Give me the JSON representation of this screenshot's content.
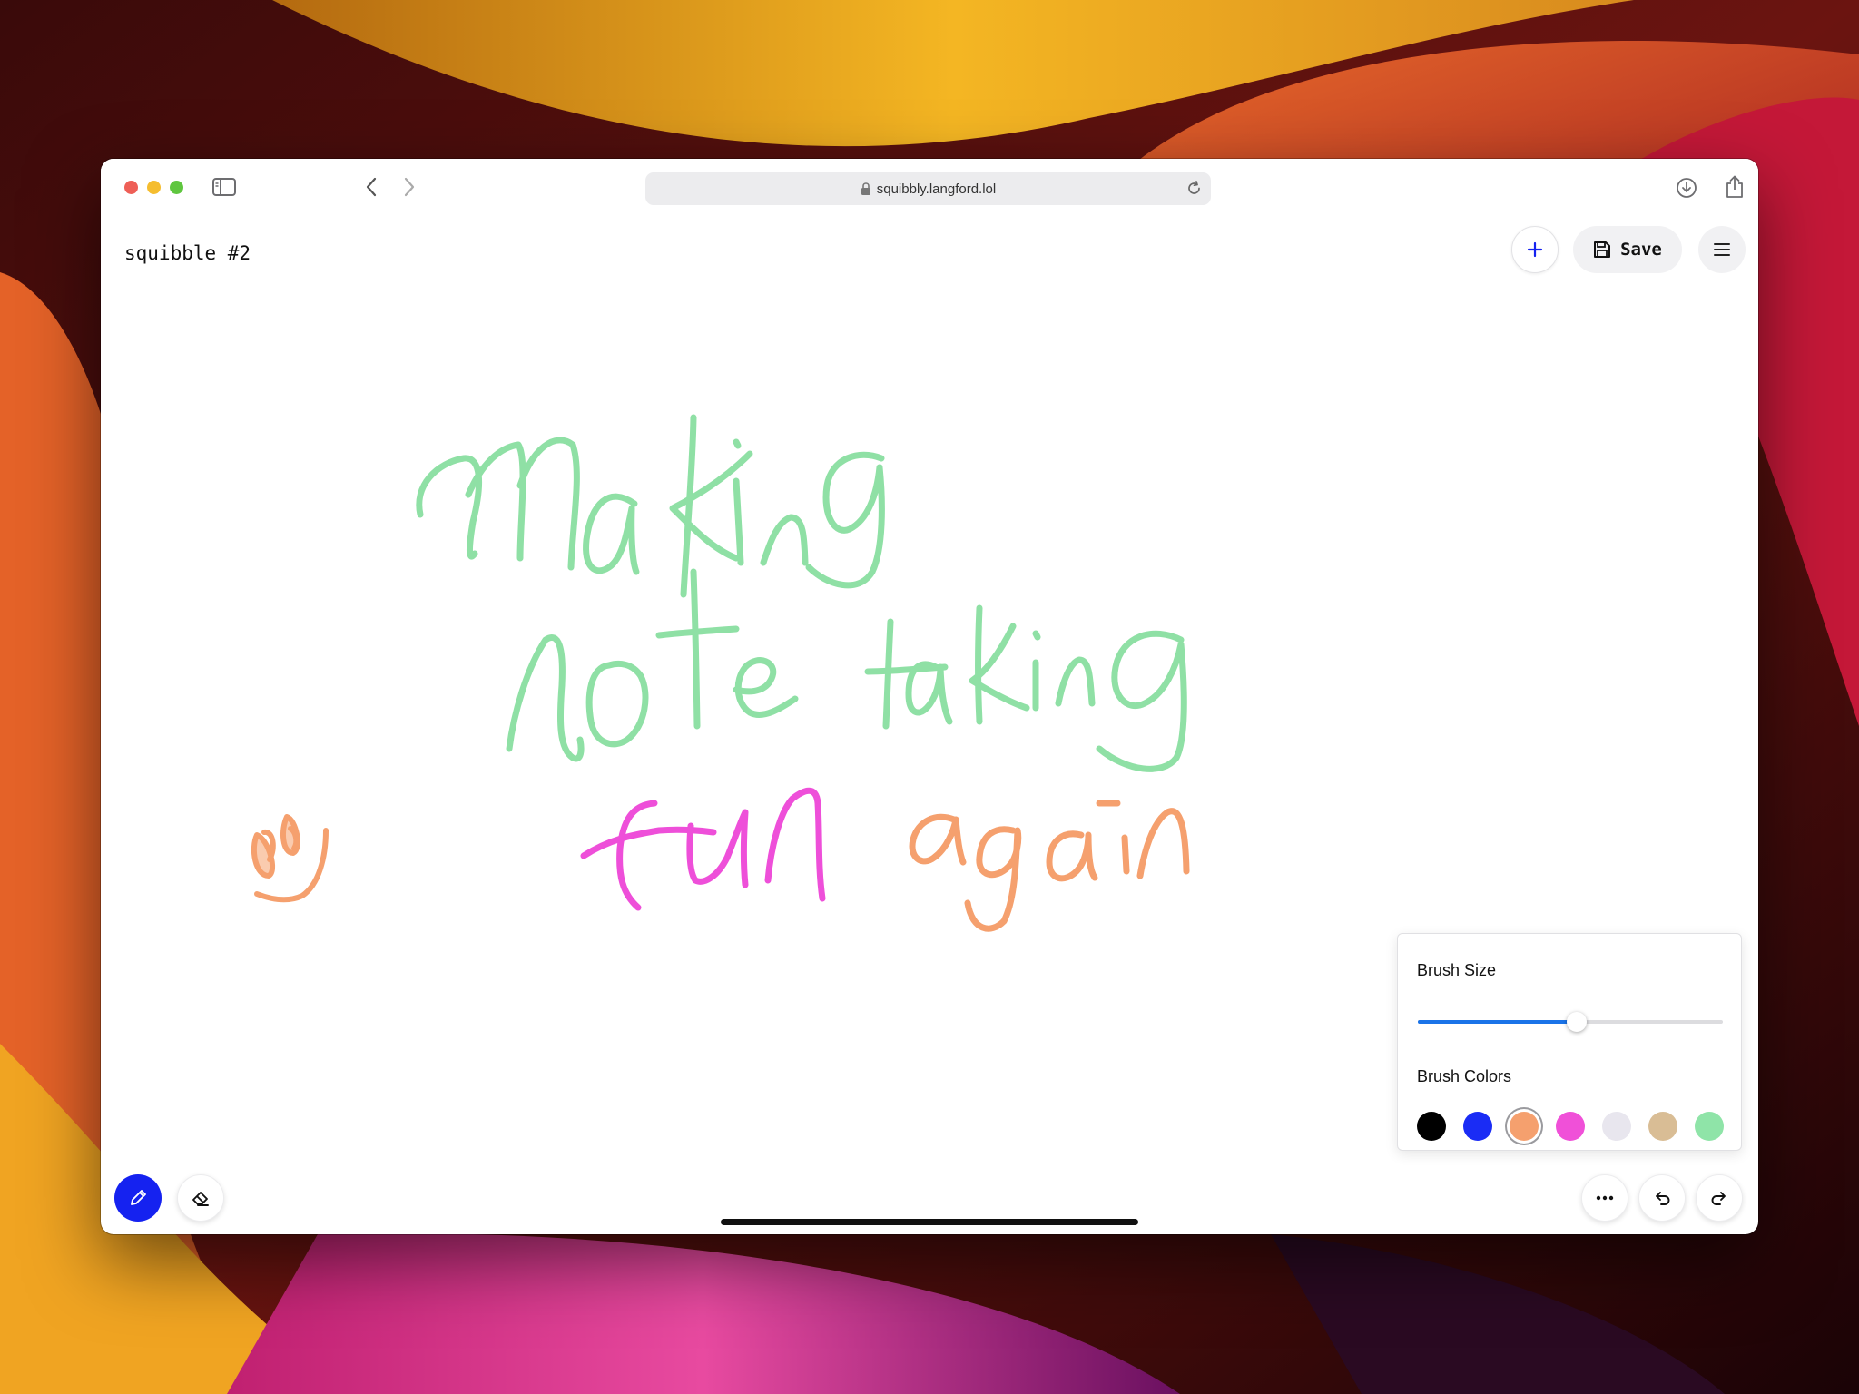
{
  "browser": {
    "url": "squibbly.langford.lol"
  },
  "app": {
    "note_title": "squibble #2",
    "save_label": "Save"
  },
  "canvas_text": {
    "line1": "Making",
    "line2": "note taking",
    "line3a": "fun",
    "line3b": "again"
  },
  "brush_panel": {
    "size_label": "Brush Size",
    "size_value_fraction": 0.52,
    "colors_label": "Brush Colors",
    "colors": [
      "#000000",
      "#1a2cf5",
      "#f5a06e",
      "#f050d8",
      "#e8e6ee",
      "#d9bd95",
      "#8fe4a8"
    ],
    "selected_color": "#f5a06e"
  },
  "theme": {
    "accent": "#1522f0",
    "ink_green": "#8fe0a5",
    "ink_pink": "#ee4fd9",
    "ink_orange": "#f5a06e"
  },
  "icons": {
    "pen": "pencil-icon",
    "eraser": "eraser-icon",
    "more": "ellipsis-icon",
    "undo": "undo-icon",
    "redo": "redo-icon"
  }
}
